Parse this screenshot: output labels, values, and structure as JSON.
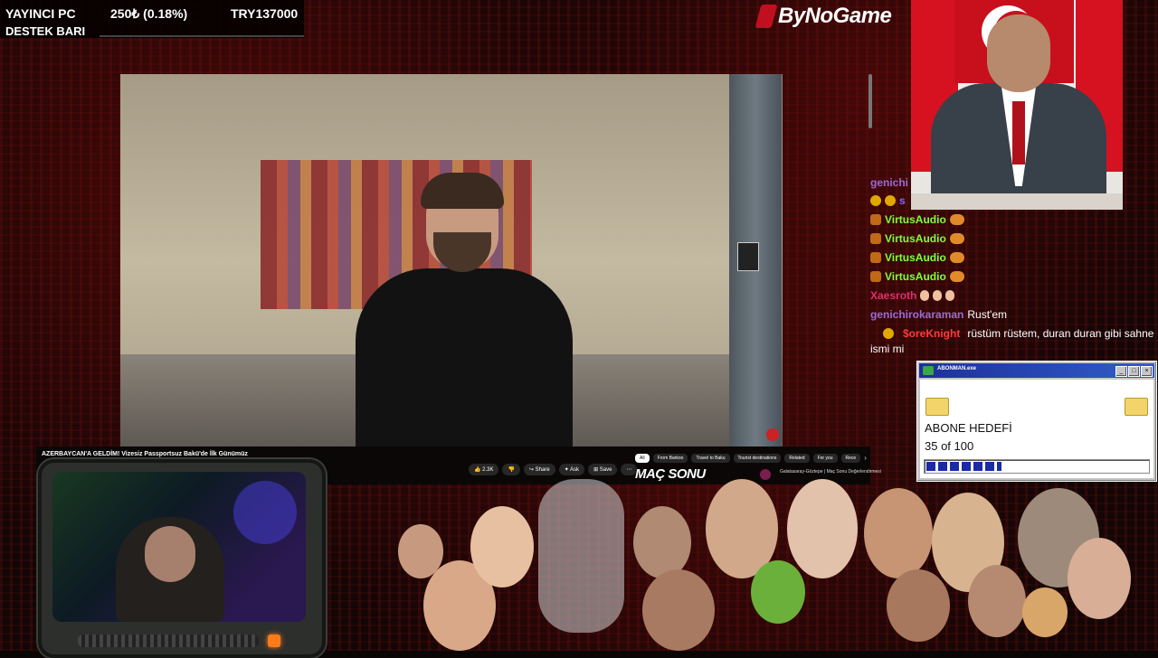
{
  "donation_bar": {
    "label_line1": "YAYINCI PC",
    "amount": "250₺ (0.18%)",
    "goal": "TRY137000",
    "label_line2": "DESTEK BARI",
    "progress_percent": 0.18
  },
  "logo": {
    "text": "ByNoGame"
  },
  "youtube": {
    "video_title": "AZERBAYCAN'A GELDİM! Vizesiz Passportsuz Bakü'de İlk Günümüz",
    "buttons": [
      {
        "label": "👍 2.3K"
      },
      {
        "label": "👎"
      },
      {
        "label": "↪ Share"
      },
      {
        "label": "✦ Ask"
      },
      {
        "label": "⊞ Save"
      },
      {
        "label": "⋯"
      }
    ],
    "chips": [
      {
        "label": "All"
      },
      {
        "label": "From Barkoo"
      },
      {
        "label": "Travel to Baku"
      },
      {
        "label": "Tourist destinations"
      },
      {
        "label": "Related"
      },
      {
        "label": "For you"
      },
      {
        "label": "Rece"
      }
    ],
    "overlay_text": "MAÇ SONU",
    "suggestion": "Galatasaray-Göztepe | Maç Sonu Değerlendirmesi"
  },
  "chat": {
    "messages": [
      {
        "user": "genichi",
        "text": "",
        "user_color": "#9b6bd6"
      },
      {
        "user": "s",
        "text": "",
        "user_color": "#7b6bff"
      },
      {
        "user": "VirtusAudio",
        "text": "",
        "user_color": "#7fff3a"
      },
      {
        "user": "VirtusAudio",
        "text": "",
        "user_color": "#7fff3a"
      },
      {
        "user": "VirtusAudio",
        "text": "",
        "user_color": "#7fff3a"
      },
      {
        "user": "VirtusAudio",
        "text": "",
        "user_color": "#7fff3a"
      },
      {
        "user": "Xaesroth",
        "text": "",
        "user_color": "#e0306a"
      },
      {
        "user": "genichirokaraman",
        "text": "Rust'em",
        "user_color": "#9b6bd6"
      },
      {
        "user": "$oreKnight",
        "text": "rüstüm rüstem, duran duran gibi sahne",
        "user_color": "#ff3a3a"
      },
      {
        "user": "",
        "text": "ismi mi",
        "user_color": "#ffffff"
      }
    ]
  },
  "subscriber_goal": {
    "window_title": "ABONMAN.exe",
    "label": "ABONE HEDEFİ",
    "count_text": "35 of 100",
    "current": 35,
    "target": 100
  },
  "colors": {
    "accent_red": "#c8101c",
    "window_blue": "#1e2f9a",
    "progress_blue": "#1a2aa8"
  }
}
